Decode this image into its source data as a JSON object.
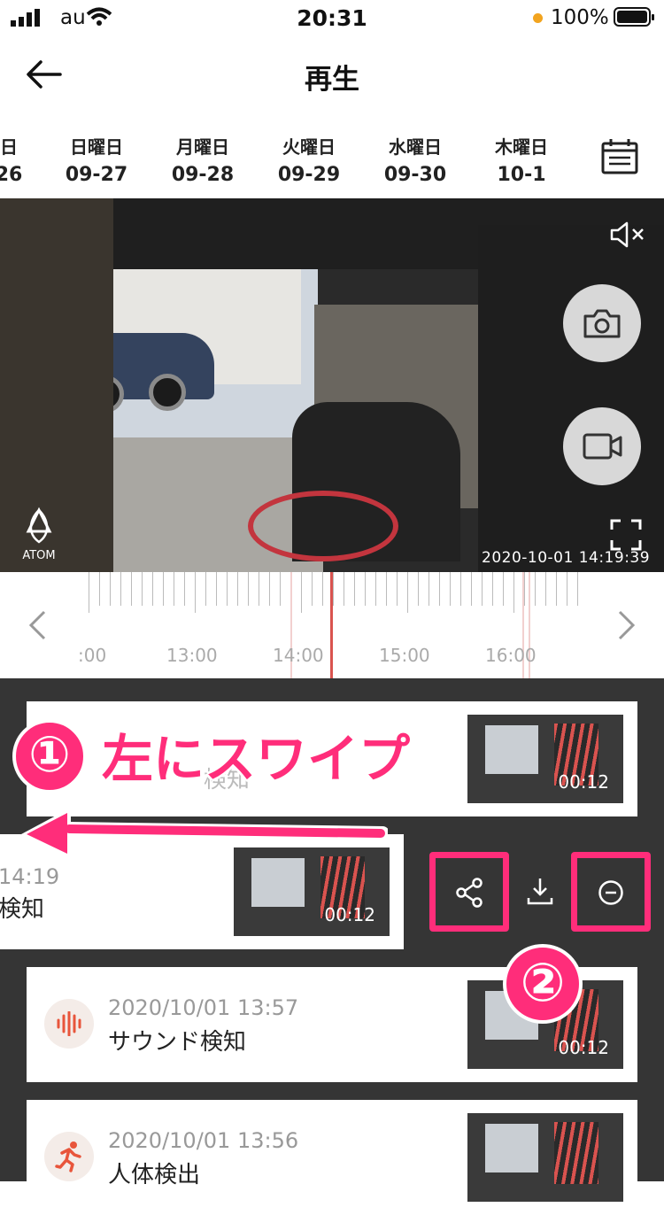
{
  "status_bar": {
    "carrier": "au",
    "time": "20:31",
    "battery": "100%"
  },
  "header": {
    "title": "再生"
  },
  "dates": [
    {
      "day": "日",
      "date": "26"
    },
    {
      "day": "日曜日",
      "date": "09-27"
    },
    {
      "day": "月曜日",
      "date": "09-28"
    },
    {
      "day": "火曜日",
      "date": "09-29"
    },
    {
      "day": "水曜日",
      "date": "09-30"
    },
    {
      "day": "木曜日",
      "date": "10-1"
    }
  ],
  "video": {
    "brand": "ATOM",
    "timestamp": "2020-10-01  14:19:39"
  },
  "timeline": {
    "labels": [
      ":00",
      "13:00",
      "14:00",
      "15:00",
      "16:00"
    ]
  },
  "events": [
    {
      "time": "",
      "label": "検知",
      "duration": "00:12"
    },
    {
      "time": "14:19",
      "label": "検知",
      "duration": "00:12"
    },
    {
      "time": "2020/10/01 13:57",
      "label": "サウンド検知",
      "duration": "00:12",
      "icon": "sound-wave-icon"
    },
    {
      "time": "2020/10/01 13:56",
      "label": "人体検出",
      "duration": "00:12",
      "icon": "running-person-icon"
    }
  ],
  "annotations": {
    "step1_number": "①",
    "step1_text": "左にスワイプ",
    "step2_number": "②"
  },
  "colors": {
    "accent": "#ff2d7a",
    "event_icon": "#e8553b",
    "playhead": "#d9534f"
  }
}
